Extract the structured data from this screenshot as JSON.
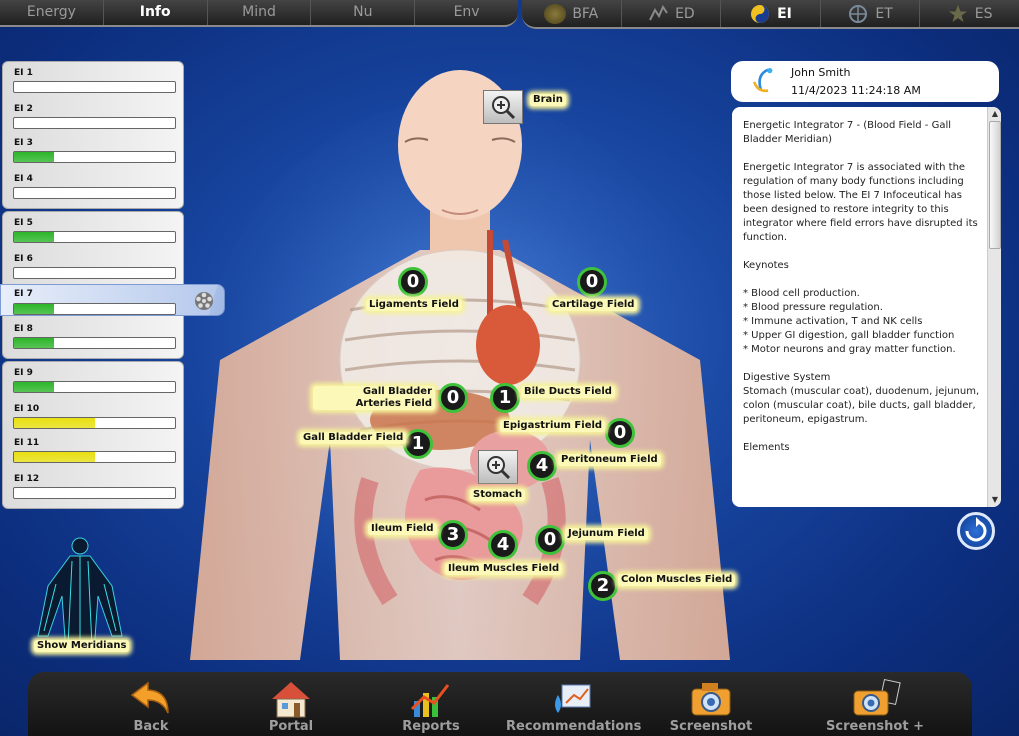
{
  "tabs_left": [
    {
      "label": "Energy"
    },
    {
      "label": "Info",
      "active": true
    },
    {
      "label": "Mind"
    },
    {
      "label": "Nu"
    },
    {
      "label": "Env"
    }
  ],
  "tabs_right": [
    {
      "label": "BFA",
      "icon": "bfa-icon"
    },
    {
      "label": "ED",
      "icon": "ed-icon"
    },
    {
      "label": "EI",
      "icon": "ei-yinyang-icon",
      "active": true
    },
    {
      "label": "ET",
      "icon": "et-icon"
    },
    {
      "label": "ES",
      "icon": "es-star-icon"
    }
  ],
  "ei_list": [
    {
      "label": "EI 1",
      "fill": 0,
      "color": "#2db52a"
    },
    {
      "label": "EI 2",
      "fill": 0,
      "color": "#2db52a"
    },
    {
      "label": "EI 3",
      "fill": 0.25,
      "color": "#2db52a"
    },
    {
      "label": "EI 4",
      "fill": 0,
      "color": "#2db52a"
    },
    {
      "label": "EI 5",
      "fill": 0.25,
      "color": "#2db52a"
    },
    {
      "label": "EI 6",
      "fill": 0,
      "color": "#2db52a"
    },
    {
      "label": "EI 7",
      "fill": 0.25,
      "color": "#2db52a",
      "selected": true
    },
    {
      "label": "EI 8",
      "fill": 0.25,
      "color": "#2db52a"
    },
    {
      "label": "EI 9",
      "fill": 0.25,
      "color": "#2db52a"
    },
    {
      "label": "EI 10",
      "fill": 0.5,
      "color": "#e8df10"
    },
    {
      "label": "EI 11",
      "fill": 0.5,
      "color": "#e8df10"
    },
    {
      "label": "EI 12",
      "fill": 0,
      "color": "#2db52a"
    }
  ],
  "fields": [
    {
      "label": "Ligaments Field",
      "value": "0"
    },
    {
      "label": "Cartilage Field",
      "value": "0"
    },
    {
      "label": "Gall Bladder Arteries Field",
      "value": "0"
    },
    {
      "label": "Bile Ducts Field",
      "value": "1"
    },
    {
      "label": "Epigastrium Field",
      "value": "0"
    },
    {
      "label": "Gall Bladder Field",
      "value": "1"
    },
    {
      "label": "Peritoneum Field",
      "value": "4"
    },
    {
      "label": "Ileum Field",
      "value": "3"
    },
    {
      "label": "Ileum Muscles Field",
      "value": "4"
    },
    {
      "label": "Jejunum Field",
      "value": "0"
    },
    {
      "label": "Colon Muscles Field",
      "value": "2"
    }
  ],
  "zoom_labels": {
    "brain": "Brain",
    "stomach": "Stomach"
  },
  "user": {
    "name": "John Smith",
    "datetime": "11/4/2023 11:24:18 AM"
  },
  "description": "Energetic Integrator 7 - (Blood Field - Gall Bladder Meridian)\n\nEnergetic Integrator 7 is associated with the regulation of many body functions including those listed below. The EI 7 Infoceutical has been designed to restore integrity to this integrator where field errors have disrupted its function.\n\nKeynotes\n\n* Blood cell production.\n* Blood pressure regulation.\n* Immune activation, T and NK cells\n* Upper GI digestion, gall bladder function\n* Motor neurons and gray matter function.\n\nDigestive System\nStomach (muscular coat), duodenum, jejunum, colon (muscular coat), bile ducts, gall bladder, peritoneum, epigastrum.\n\nElements",
  "show_meridians": "Show Meridians",
  "toolbar": [
    {
      "label": "Back",
      "icon": "back-arrow-icon"
    },
    {
      "label": "Portal",
      "icon": "house-icon"
    },
    {
      "label": "Reports",
      "icon": "chart-icon"
    },
    {
      "label": "Recommendations",
      "icon": "recommendations-icon"
    },
    {
      "label": "Screenshot",
      "icon": "camera-icon"
    },
    {
      "label": "Screenshot +",
      "icon": "camera-plus-icon"
    }
  ]
}
